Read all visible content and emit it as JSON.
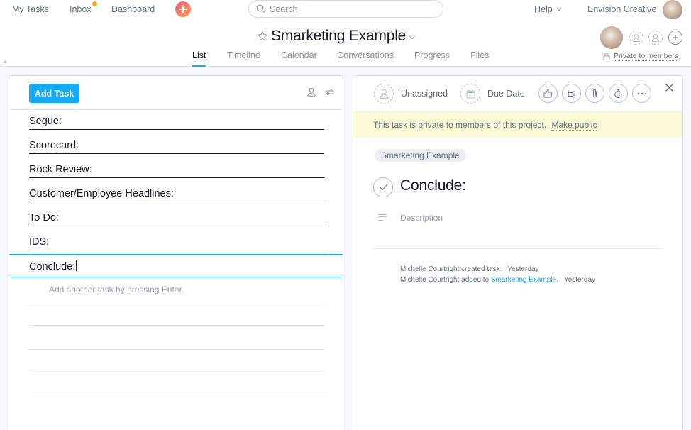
{
  "topbar": {
    "nav": [
      {
        "label": "My Tasks"
      },
      {
        "label": "Inbox",
        "has_notification": true
      },
      {
        "label": "Dashboard"
      }
    ],
    "quick_add_icon": "plus-icon",
    "search": {
      "placeholder": "Search",
      "value": ""
    },
    "help_label": "Help",
    "workspace_label": "Envision Creative"
  },
  "project": {
    "title": "Smarketing Example",
    "favorite_icon": "star-outline-icon",
    "tabs": [
      {
        "label": "List",
        "active": true
      },
      {
        "label": "Timeline"
      },
      {
        "label": "Calendar"
      },
      {
        "label": "Conversations"
      },
      {
        "label": "Progress"
      },
      {
        "label": "Files"
      }
    ],
    "privacy_label": "Private to members"
  },
  "task_list": {
    "add_task_label": "Add Task",
    "tasks": [
      {
        "name": "Segue:",
        "type": "section"
      },
      {
        "name": "Scorecard:",
        "type": "section"
      },
      {
        "name": "Rock Review:",
        "type": "section"
      },
      {
        "name": "Customer/Employee Headlines:",
        "type": "section"
      },
      {
        "name": "To Do:",
        "type": "section"
      },
      {
        "name": "IDS:",
        "type": "section"
      },
      {
        "name": "Conclude:",
        "type": "section",
        "selected": true,
        "editing": true
      }
    ],
    "add_another_hint": "Add another task by pressing Enter."
  },
  "task_detail": {
    "assignee_label": "Unassigned",
    "due_date_label": "Due Date",
    "actions": [
      "like-icon",
      "subtask-icon",
      "attachment-icon",
      "timer-icon",
      "more-icon"
    ],
    "private_banner": {
      "text": "This task is private to members of this project.",
      "link": "Make public"
    },
    "project_tag": "Smarketing Example",
    "title": "Conclude:",
    "description_placeholder": "Description",
    "stories": [
      {
        "text": "Michelle Courtright created task.",
        "timestamp": "Yesterday"
      },
      {
        "text": "Michelle Courtright added to",
        "link": "Smarketing Example",
        "suffix": ".",
        "timestamp": "Yesterday"
      }
    ]
  },
  "colors": {
    "accent": "#14aaf5",
    "banner_bg": "#fcfad6",
    "notification_dot": "#f8a12a"
  }
}
